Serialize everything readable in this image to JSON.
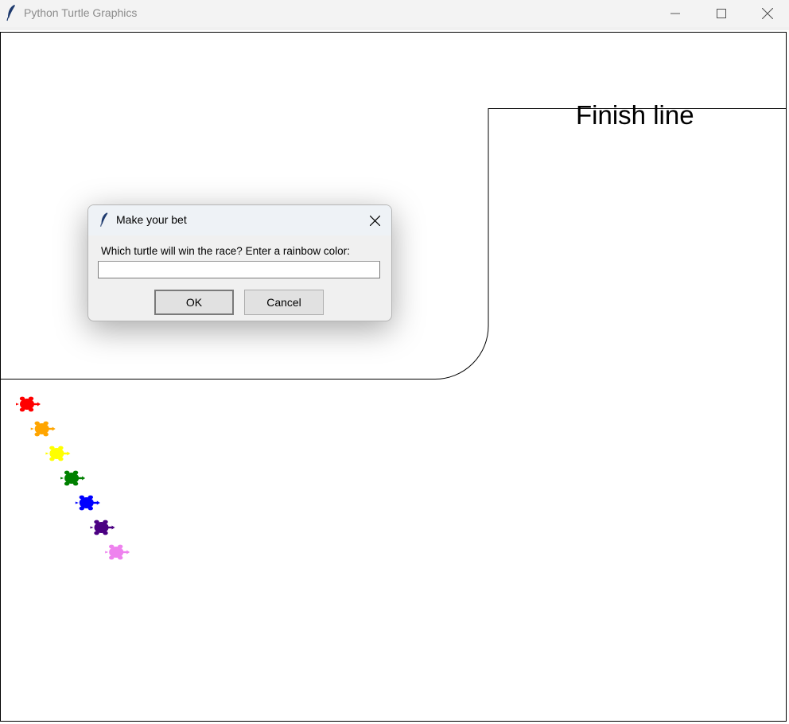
{
  "window": {
    "title": "Python Turtle Graphics",
    "icon": "feather-icon"
  },
  "window_controls": {
    "minimize_icon": "minimize-icon",
    "maximize_icon": "maximize-icon",
    "close_icon": "close-icon"
  },
  "canvas": {
    "finish_label": "Finish line",
    "turtles": [
      {
        "color": "#ff0000",
        "name": "red"
      },
      {
        "color": "#ffa500",
        "name": "orange"
      },
      {
        "color": "#ffff00",
        "name": "yellow"
      },
      {
        "color": "#008000",
        "name": "green"
      },
      {
        "color": "#0000ff",
        "name": "blue"
      },
      {
        "color": "#4b0082",
        "name": "indigo"
      },
      {
        "color": "#ee82ee",
        "name": "violet"
      }
    ]
  },
  "dialog": {
    "title": "Make your bet",
    "prompt": "Which turtle will win the race? Enter a rainbow color:",
    "input_value": "",
    "ok_label": "OK",
    "cancel_label": "Cancel"
  }
}
